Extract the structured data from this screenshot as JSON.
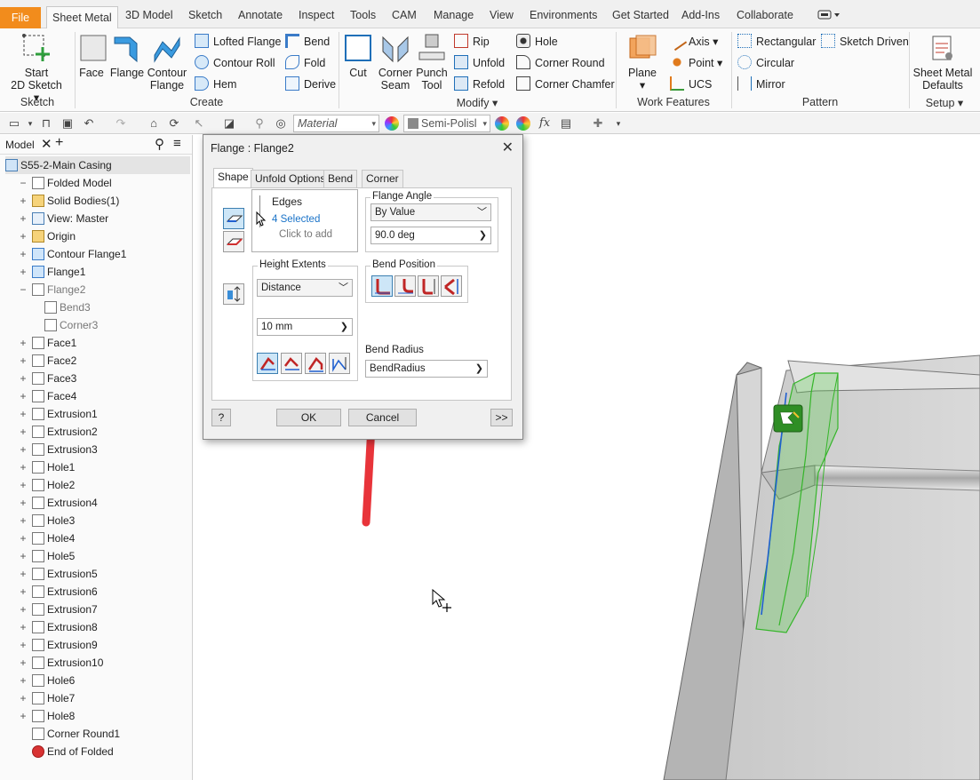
{
  "menu": {
    "tabs": [
      "File",
      "Sheet Metal",
      "3D Model",
      "Sketch",
      "Annotate",
      "Inspect",
      "Tools",
      "CAM",
      "Manage",
      "View",
      "Environments",
      "Get Started",
      "Add-Ins",
      "Collaborate"
    ]
  },
  "ribbon": {
    "sketch": {
      "start_l1": "Start",
      "start_l2": "2D Sketch",
      "group": "Sketch"
    },
    "create": {
      "face": "Face",
      "flange": "Flange",
      "contour_l1": "Contour",
      "contour_l2": "Flange",
      "lofted": "Lofted Flange",
      "contour_roll": "Contour Roll",
      "hem": "Hem",
      "bend": "Bend",
      "fold": "Fold",
      "derive": "Derive",
      "group": "Create"
    },
    "modify": {
      "cut": "Cut",
      "corner_l1": "Corner",
      "corner_l2": "Seam",
      "punch_l1": "Punch",
      "punch_l2": "Tool",
      "rip": "Rip",
      "unfold": "Unfold",
      "refold": "Refold",
      "hole": "Hole",
      "corner_round": "Corner Round",
      "corner_chamfer": "Corner Chamfer",
      "group": "Modify"
    },
    "work": {
      "plane": "Plane",
      "axis": "Axis",
      "point": "Point",
      "ucs": "UCS",
      "group": "Work Features"
    },
    "pattern": {
      "rect": "Rectangular",
      "circ": "Circular",
      "mirror": "Mirror",
      "sketch_driven": "Sketch Driven",
      "group": "Pattern"
    },
    "setup": {
      "defaults_l1": "Sheet Metal",
      "defaults_l2": "Defaults",
      "group": "Setup"
    }
  },
  "qat": {
    "material": "Material",
    "appearance": "Semi-Polisl"
  },
  "browser": {
    "tab": "Model",
    "root": "S55-2-Main Casing",
    "items": [
      {
        "label": "Folded Model",
        "exp": "−"
      },
      {
        "label": "Solid Bodies(1)",
        "exp": "+"
      },
      {
        "label": "View: Master",
        "exp": "+"
      },
      {
        "label": "Origin",
        "exp": "+"
      },
      {
        "label": "Contour Flange1",
        "exp": "+"
      },
      {
        "label": "Flange1",
        "exp": "+"
      },
      {
        "label": "Flange2",
        "exp": "−"
      },
      {
        "label": "Bend3",
        "exp": ""
      },
      {
        "label": "Corner3",
        "exp": ""
      },
      {
        "label": "Face1",
        "exp": "+"
      },
      {
        "label": "Face2",
        "exp": "+"
      },
      {
        "label": "Face3",
        "exp": "+"
      },
      {
        "label": "Face4",
        "exp": "+"
      },
      {
        "label": "Extrusion1",
        "exp": "+"
      },
      {
        "label": "Extrusion2",
        "exp": "+"
      },
      {
        "label": "Extrusion3",
        "exp": "+"
      },
      {
        "label": "Hole1",
        "exp": "+"
      },
      {
        "label": "Hole2",
        "exp": "+"
      },
      {
        "label": "Extrusion4",
        "exp": "+"
      },
      {
        "label": "Hole3",
        "exp": "+"
      },
      {
        "label": "Hole4",
        "exp": "+"
      },
      {
        "label": "Hole5",
        "exp": "+"
      },
      {
        "label": "Extrusion5",
        "exp": "+"
      },
      {
        "label": "Extrusion6",
        "exp": "+"
      },
      {
        "label": "Extrusion7",
        "exp": "+"
      },
      {
        "label": "Extrusion8",
        "exp": "+"
      },
      {
        "label": "Extrusion9",
        "exp": "+"
      },
      {
        "label": "Extrusion10",
        "exp": "+"
      },
      {
        "label": "Hole6",
        "exp": "+"
      },
      {
        "label": "Hole7",
        "exp": "+"
      },
      {
        "label": "Hole8",
        "exp": "+"
      },
      {
        "label": "Corner Round1",
        "exp": ""
      },
      {
        "label": "End of Folded",
        "exp": ""
      }
    ]
  },
  "dialog": {
    "title": "Flange : Flange2",
    "tabs": [
      "Shape",
      "Unfold Options",
      "Bend",
      "Corner"
    ],
    "edges_label": "Edges",
    "edges_selected": "4 Selected",
    "edges_hint": "Click to add",
    "flange_angle_label": "Flange Angle",
    "angle_mode": "By Value",
    "angle_value": "90.0 deg",
    "height_extents_label": "Height Extents",
    "height_mode": "Distance",
    "height_value": "10 mm",
    "bend_position_label": "Bend Position",
    "bend_radius_label": "Bend Radius",
    "bend_radius_value": "BendRadius",
    "ok": "OK",
    "cancel": "Cancel",
    "more": ">>",
    "help": "?"
  },
  "colors": {
    "file_tab": "#f28c1c",
    "selection_green": "#4ccc3c",
    "arrow_red": "#e8343a",
    "accent_blue": "#1a73c8"
  }
}
